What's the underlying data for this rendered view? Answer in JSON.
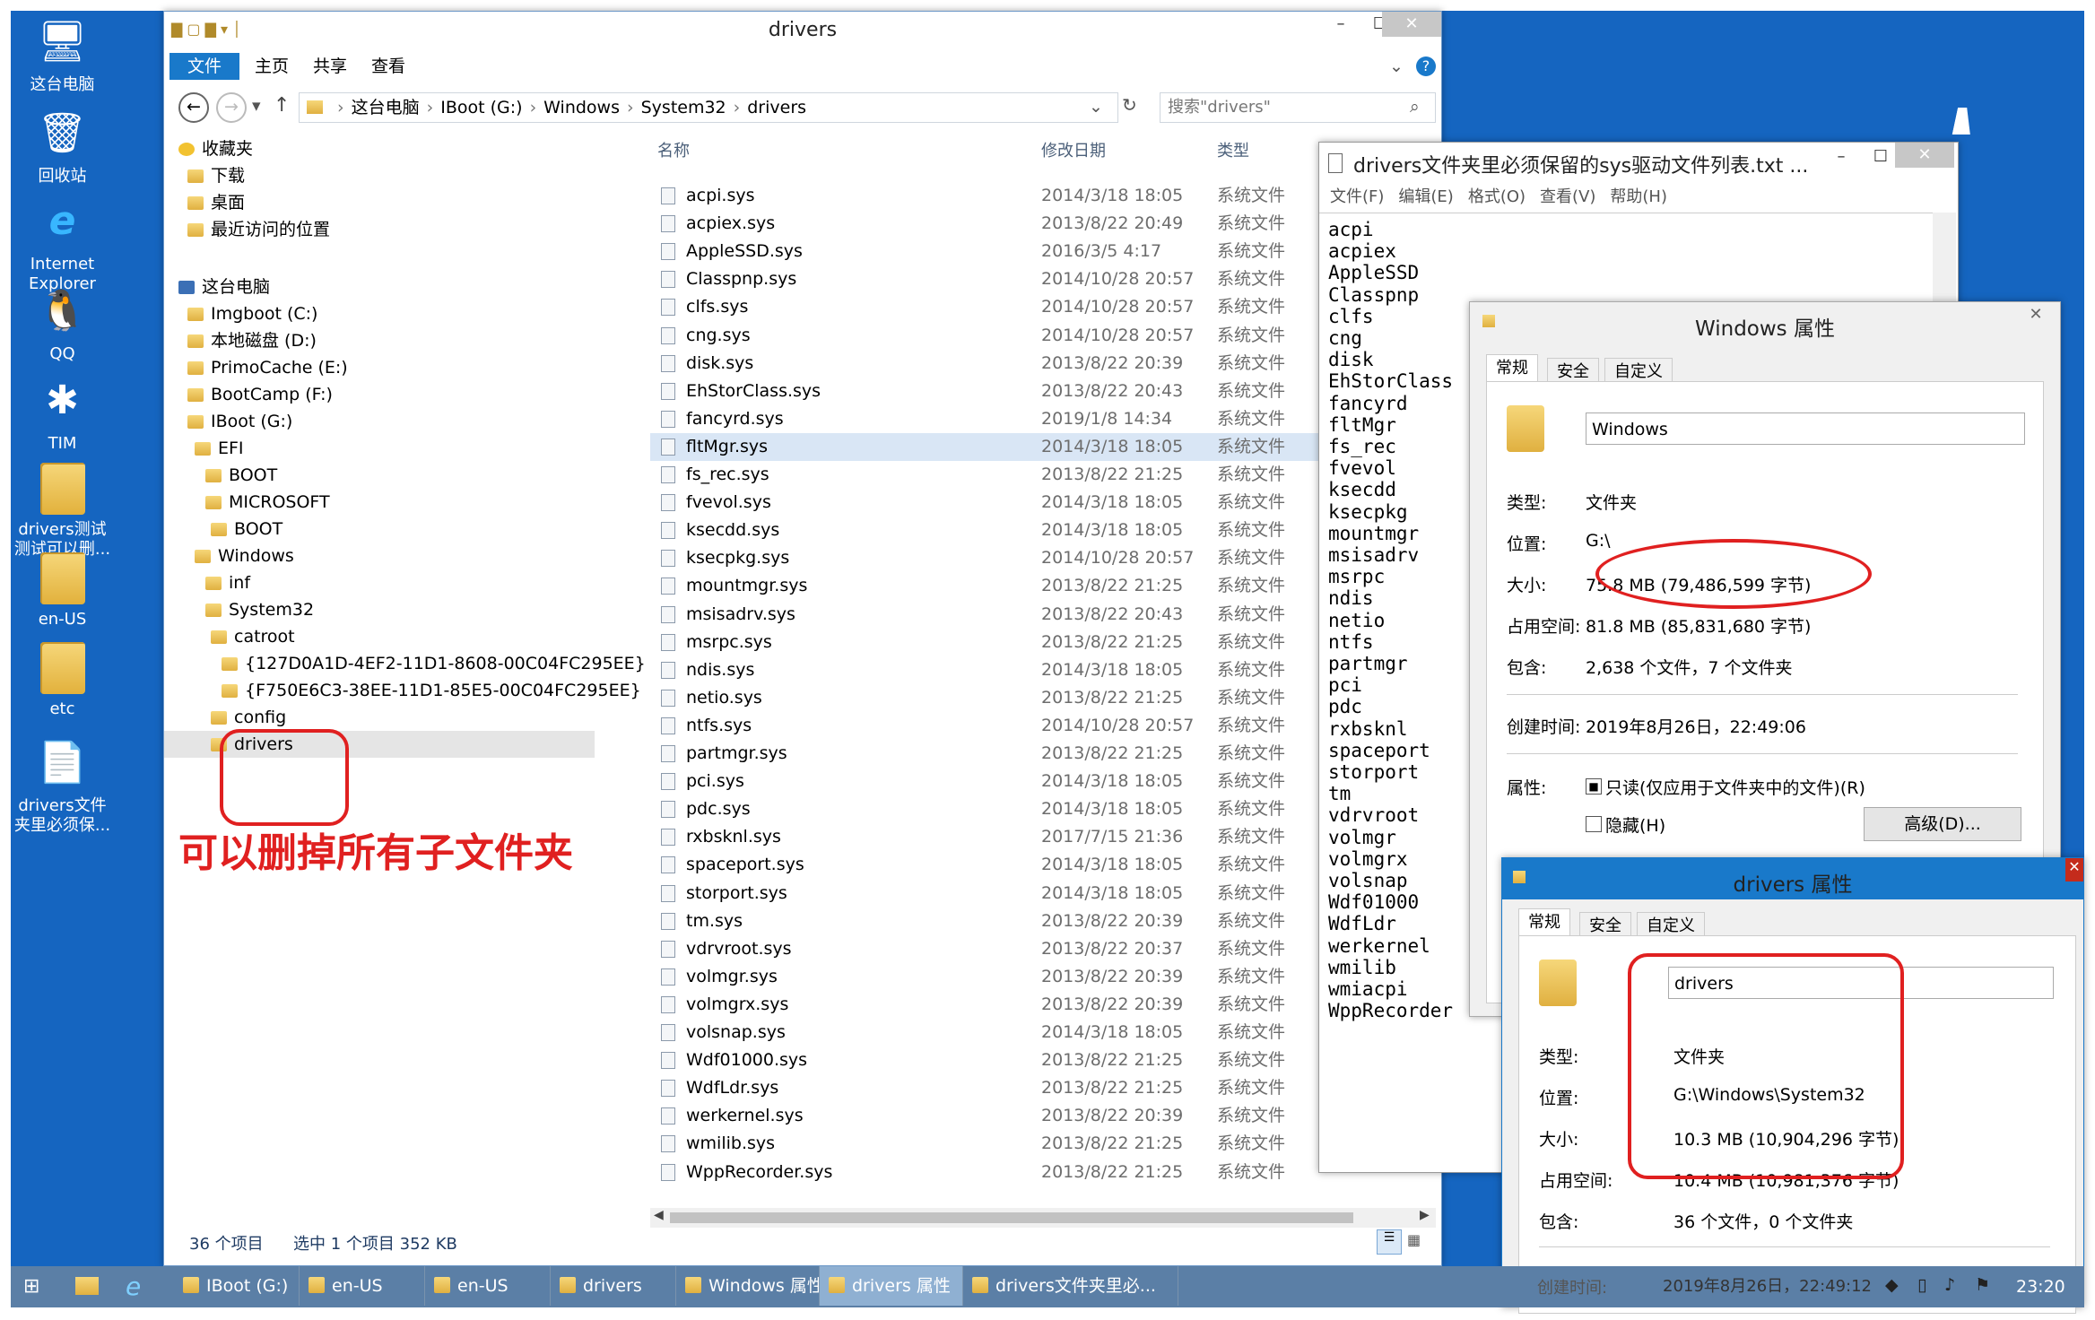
{
  "desktop": {
    "icons": [
      {
        "label": "这台电脑",
        "icon": "computer-icon"
      },
      {
        "label": "回收站",
        "icon": "recycle-bin-icon"
      },
      {
        "label": "Internet Explorer",
        "icon": "ie-icon"
      },
      {
        "label": "QQ",
        "icon": "qq-icon"
      },
      {
        "label": "TIM",
        "icon": "tim-icon"
      },
      {
        "label": "drivers测试测试可以删...",
        "icon": "folder-icon"
      },
      {
        "label": "en-US",
        "icon": "folder-icon"
      },
      {
        "label": "etc",
        "icon": "folder-icon"
      },
      {
        "label": "drivers文件夹里必须保...",
        "icon": "text-file-icon"
      }
    ]
  },
  "explorer": {
    "title": "drivers",
    "ribbon_tabs": [
      "文件",
      "主页",
      "共享",
      "查看"
    ],
    "breadcrumb": [
      "这台电脑",
      "IBoot (G:)",
      "Windows",
      "System32",
      "drivers"
    ],
    "search_placeholder": "搜索\"drivers\"",
    "nav": [
      {
        "label": "收藏夹",
        "indent": 0
      },
      {
        "label": "下载",
        "indent": 1
      },
      {
        "label": "桌面",
        "indent": 1
      },
      {
        "label": "最近访问的位置",
        "indent": 1
      },
      {
        "label": "这台电脑",
        "indent": 0
      },
      {
        "label": "Imgboot (C:)",
        "indent": 1
      },
      {
        "label": "本地磁盘 (D:)",
        "indent": 1
      },
      {
        "label": "PrimoCache (E:)",
        "indent": 1
      },
      {
        "label": "BootCamp (F:)",
        "indent": 1
      },
      {
        "label": "IBoot (G:)",
        "indent": 1
      },
      {
        "label": "EFI",
        "indent": 2
      },
      {
        "label": "BOOT",
        "indent": 3
      },
      {
        "label": "MICROSOFT",
        "indent": 3
      },
      {
        "label": "BOOT",
        "indent": 4
      },
      {
        "label": "Windows",
        "indent": 2
      },
      {
        "label": "inf",
        "indent": 3
      },
      {
        "label": "System32",
        "indent": 3
      },
      {
        "label": "catroot",
        "indent": 4
      },
      {
        "label": "{127D0A1D-4EF2-11D1-8608-00C04FC295EE}",
        "indent": 5
      },
      {
        "label": "{F750E6C3-38EE-11D1-85E5-00C04FC295EE}",
        "indent": 5
      },
      {
        "label": "config",
        "indent": 4
      },
      {
        "label": "drivers",
        "indent": 4
      }
    ],
    "annotation": "可以删掉所有子文件夹",
    "columns": [
      "名称",
      "修改日期",
      "类型"
    ],
    "files": [
      {
        "name": "acpi.sys",
        "date": "2014/3/18 18:05",
        "type": "系统文件"
      },
      {
        "name": "acpiex.sys",
        "date": "2013/8/22 20:49",
        "type": "系统文件"
      },
      {
        "name": "AppleSSD.sys",
        "date": "2016/3/5 4:17",
        "type": "系统文件"
      },
      {
        "name": "Classpnp.sys",
        "date": "2014/10/28 20:57",
        "type": "系统文件"
      },
      {
        "name": "clfs.sys",
        "date": "2014/10/28 20:57",
        "type": "系统文件"
      },
      {
        "name": "cng.sys",
        "date": "2014/10/28 20:57",
        "type": "系统文件"
      },
      {
        "name": "disk.sys",
        "date": "2013/8/22 20:39",
        "type": "系统文件"
      },
      {
        "name": "EhStorClass.sys",
        "date": "2013/8/22 20:43",
        "type": "系统文件"
      },
      {
        "name": "fancyrd.sys",
        "date": "2019/1/8 14:34",
        "type": "系统文件"
      },
      {
        "name": "fltMgr.sys",
        "date": "2014/3/18 18:05",
        "type": "系统文件"
      },
      {
        "name": "fs_rec.sys",
        "date": "2013/8/22 21:25",
        "type": "系统文件"
      },
      {
        "name": "fvevol.sys",
        "date": "2014/3/18 18:05",
        "type": "系统文件"
      },
      {
        "name": "ksecdd.sys",
        "date": "2014/3/18 18:05",
        "type": "系统文件"
      },
      {
        "name": "ksecpkg.sys",
        "date": "2014/10/28 20:57",
        "type": "系统文件"
      },
      {
        "name": "mountmgr.sys",
        "date": "2013/8/22 21:25",
        "type": "系统文件"
      },
      {
        "name": "msisadrv.sys",
        "date": "2013/8/22 20:43",
        "type": "系统文件"
      },
      {
        "name": "msrpc.sys",
        "date": "2013/8/22 21:25",
        "type": "系统文件"
      },
      {
        "name": "ndis.sys",
        "date": "2014/3/18 18:05",
        "type": "系统文件"
      },
      {
        "name": "netio.sys",
        "date": "2013/8/22 21:25",
        "type": "系统文件"
      },
      {
        "name": "ntfs.sys",
        "date": "2014/10/28 20:57",
        "type": "系统文件"
      },
      {
        "name": "partmgr.sys",
        "date": "2013/8/22 21:25",
        "type": "系统文件"
      },
      {
        "name": "pci.sys",
        "date": "2014/3/18 18:05",
        "type": "系统文件"
      },
      {
        "name": "pdc.sys",
        "date": "2014/3/18 18:05",
        "type": "系统文件"
      },
      {
        "name": "rxbsknl.sys",
        "date": "2017/7/15 21:36",
        "type": "系统文件"
      },
      {
        "name": "spaceport.sys",
        "date": "2014/3/18 18:05",
        "type": "系统文件"
      },
      {
        "name": "storport.sys",
        "date": "2014/3/18 18:05",
        "type": "系统文件"
      },
      {
        "name": "tm.sys",
        "date": "2013/8/22 20:39",
        "type": "系统文件"
      },
      {
        "name": "vdrvroot.sys",
        "date": "2013/8/22 20:37",
        "type": "系统文件"
      },
      {
        "name": "volmgr.sys",
        "date": "2013/8/22 20:39",
        "type": "系统文件"
      },
      {
        "name": "volmgrx.sys",
        "date": "2013/8/22 20:39",
        "type": "系统文件"
      },
      {
        "name": "volsnap.sys",
        "date": "2014/3/18 18:05",
        "type": "系统文件"
      },
      {
        "name": "Wdf01000.sys",
        "date": "2013/8/22 21:25",
        "type": "系统文件"
      },
      {
        "name": "WdfLdr.sys",
        "date": "2013/8/22 21:25",
        "type": "系统文件"
      },
      {
        "name": "werkernel.sys",
        "date": "2013/8/22 20:39",
        "type": "系统文件"
      },
      {
        "name": "wmilib.sys",
        "date": "2013/8/22 21:25",
        "type": "系统文件"
      },
      {
        "name": "WppRecorder.sys",
        "date": "2013/8/22 21:25",
        "type": "系统文件"
      }
    ],
    "status_count": "36 个项目",
    "status_selected": "选中 1 个项目  352 KB"
  },
  "notepad": {
    "title": "drivers文件夹里必须保留的sys驱动文件列表.txt ...",
    "menu": [
      "文件(F)",
      "编辑(E)",
      "格式(O)",
      "查看(V)",
      "帮助(H)"
    ],
    "lines": [
      "acpi",
      "acpiex",
      "AppleSSD",
      "Classpnp",
      "clfs",
      "cng",
      "disk",
      "EhStorClass",
      "fancyrd",
      "fltMgr",
      "fs_rec",
      "fvevol",
      "ksecdd",
      "ksecpkg",
      "mountmgr",
      "msisadrv",
      "msrpc",
      "ndis",
      "netio",
      "ntfs",
      "partmgr",
      "pci",
      "pdc",
      "rxbsknl",
      "spaceport",
      "storport",
      "tm",
      "vdrvroot",
      "volmgr",
      "volmgrx",
      "volsnap",
      "Wdf01000",
      "WdfLdr",
      "werkernel",
      "wmilib",
      "wmiacpi",
      "WppRecorder"
    ]
  },
  "windows_props": {
    "title": "Windows 属性",
    "tabs": [
      "常规",
      "安全",
      "自定义"
    ],
    "name": "Windows",
    "type_label": "类型:",
    "type": "文件夹",
    "location_label": "位置:",
    "location": "G:\\",
    "size_label": "大小:",
    "size": "75.8 MB (79,486,599 字节)",
    "disk_label": "占用空间:",
    "disk": "81.8 MB (85,831,680 字节)",
    "contains_label": "包含:",
    "contains": "2,638 个文件，7 个文件夹",
    "created_label": "创建时间:",
    "created": "2019年8月26日，22:49:06",
    "attr_label": "属性:",
    "readonly": "只读(仅应用于文件夹中的文件)(R)",
    "hidden": "隐藏(H)",
    "advanced": "高级(D)..."
  },
  "drivers_props": {
    "title": "drivers 属性",
    "tabs": [
      "常规",
      "安全",
      "自定义"
    ],
    "name": "drivers",
    "type_label": "类型:",
    "type": "文件夹",
    "location_label": "位置:",
    "location": "G:\\Windows\\System32",
    "size_label": "大小:",
    "size": "10.3 MB (10,904,296 字节)",
    "disk_label": "占用空间:",
    "disk": "10.4 MB (10,981,376 字节)",
    "contains_label": "包含:",
    "contains": "36 个文件，0 个文件夹",
    "created_label": "创建时间:",
    "created": "2019年8月26日，22:49:12"
  },
  "taskbar": {
    "items": [
      "IBoot (G:)",
      "en-US",
      "en-US",
      "drivers",
      "Windows 属性",
      "drivers 属性",
      "drivers文件夹里必..."
    ],
    "clock": "23:20"
  },
  "colors": {
    "desktop": "#1565c0",
    "annotation": "#e02020",
    "taskbar": "#5b7fa6",
    "accent": "#1979ca"
  }
}
